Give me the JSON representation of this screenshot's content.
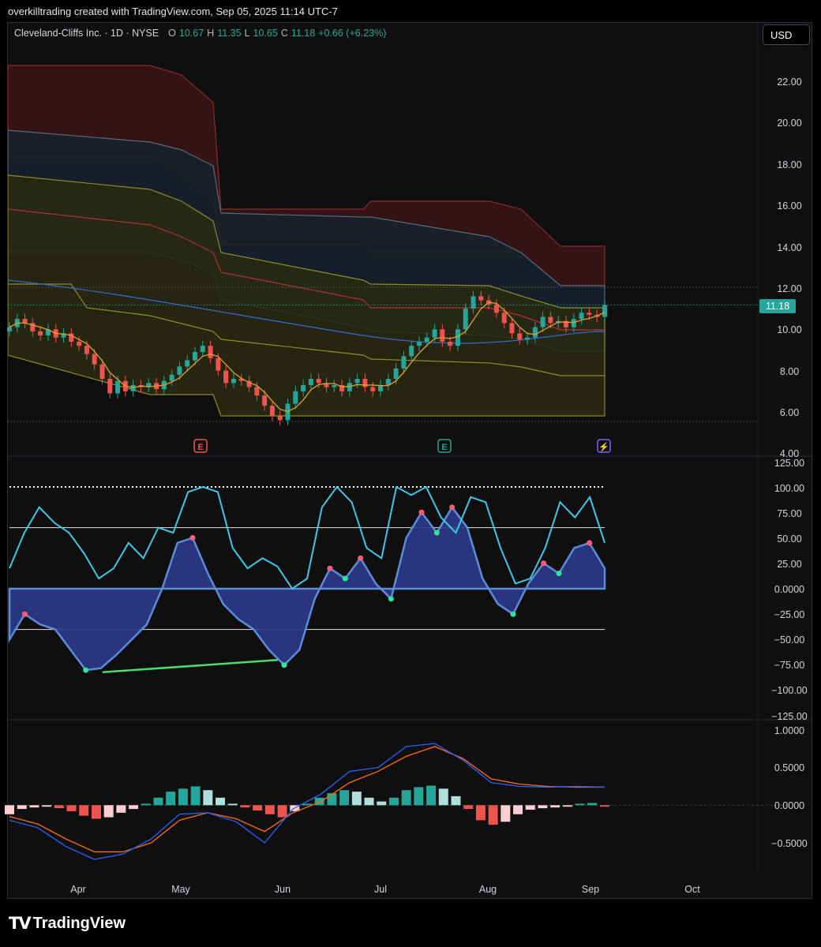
{
  "caption": "overkilltrading created with TradingView.com, Sep 05, 2025 11:14 UTC-7",
  "header": {
    "symbol": "Cleveland-Cliffs Inc. · 1D · NYSE",
    "o_label": "O",
    "o_value": "10.67",
    "h_label": "H",
    "h_value": "11.35",
    "l_label": "L",
    "l_value": "10.65",
    "c_label": "C",
    "c_value": "11.18",
    "change": "+0.66 (+6.23%)",
    "currency": "USD"
  },
  "logo": {
    "mark": "TV",
    "text": "TradingView"
  },
  "colors": {
    "up": "#26a69a",
    "down": "#ef5350",
    "price_line": "#26a69a",
    "wave_line": "#3cc8e8",
    "wave_fill": "#2e3a8c",
    "macd": "#2962ff",
    "signal": "#ff6d00",
    "earnings_down": "#ef5350",
    "earnings_up": "#26a69a",
    "dividend": "#7b61ff"
  },
  "events": [
    {
      "label": "E",
      "month": "May",
      "kind": "earnings_down"
    },
    {
      "label": "E",
      "month": "Jul",
      "kind": "earnings_up"
    },
    {
      "label": "⚡",
      "month": "Sep",
      "kind": "dividend"
    }
  ],
  "chart_data": [
    {
      "type": "candlestick",
      "title": "Cleveland-Cliffs Inc. · 1D · NYSE",
      "last_price": 11.18,
      "last_price_label": "11.18",
      "y_ticks": [
        "22.00",
        "20.00",
        "18.00",
        "16.00",
        "14.00",
        "12.00",
        "10.00",
        "8.00",
        "6.00",
        "4.00"
      ],
      "ylim": [
        4,
        24
      ],
      "x_ticks": [
        "Apr",
        "May",
        "Jun",
        "Jul",
        "Aug",
        "Sep",
        "Oct"
      ],
      "close": [
        10.1,
        10.5,
        10.3,
        9.9,
        9.7,
        10.0,
        9.6,
        9.8,
        9.4,
        9.2,
        8.8,
        8.3,
        7.6,
        6.9,
        7.5,
        7.0,
        7.3,
        7.2,
        7.4,
        7.1,
        7.5,
        7.8,
        8.2,
        8.5,
        8.9,
        9.2,
        8.6,
        8.0,
        7.4,
        7.6,
        7.5,
        7.2,
        6.8,
        6.3,
        5.8,
        5.6,
        6.4,
        7.0,
        7.3,
        7.6,
        7.4,
        7.2,
        7.3,
        7.0,
        7.4,
        7.6,
        7.2,
        7.0,
        7.3,
        7.6,
        8.1,
        8.7,
        9.2,
        9.4,
        9.6,
        10.0,
        9.4,
        9.2,
        10.0,
        11.0,
        11.6,
        11.4,
        11.2,
        10.8,
        10.3,
        9.8,
        9.5,
        9.6,
        10.1,
        10.6,
        10.3,
        10.4,
        10.1,
        10.5,
        10.8,
        10.7,
        10.6,
        11.18
      ]
    },
    {
      "type": "line",
      "y_ticks": [
        "125.00",
        "100.00",
        "75.00",
        "50.00",
        "25.00",
        "0.0000",
        "−25.00",
        "−50.00",
        "−75.00",
        "−100.00",
        "−125.00"
      ],
      "ylim": [
        -125,
        125
      ],
      "levels": [
        100,
        60,
        0,
        -40
      ],
      "series": [
        {
          "values": [
            20,
            55,
            80,
            65,
            55,
            35,
            10,
            20,
            45,
            30,
            60,
            55,
            95,
            100,
            95,
            40,
            20,
            30,
            22,
            0,
            10,
            80,
            100,
            85,
            40,
            30,
            100,
            92,
            100,
            70,
            55,
            90,
            85,
            40,
            5,
            10,
            40,
            85,
            70,
            90,
            45
          ]
        },
        {
          "values": [
            -50,
            -25,
            -35,
            -40,
            -60,
            -80,
            -78,
            -65,
            -50,
            -35,
            0,
            45,
            50,
            15,
            -15,
            -30,
            -40,
            -60,
            -75,
            -60,
            -10,
            20,
            10,
            30,
            5,
            -10,
            50,
            75,
            55,
            80,
            60,
            10,
            -15,
            -25,
            5,
            25,
            15,
            40,
            45,
            20
          ]
        }
      ],
      "annotations": [
        {
          "type": "divergence",
          "from": -82,
          "to": -70
        }
      ]
    },
    {
      "type": "bar",
      "y_ticks": [
        "1.0000",
        "0.5000",
        "0.0000",
        "−0.5000"
      ],
      "ylim": [
        -0.75,
        1.05
      ],
      "histogram": [
        -0.12,
        -0.05,
        -0.03,
        -0.02,
        -0.04,
        -0.08,
        -0.14,
        -0.18,
        -0.16,
        -0.1,
        -0.05,
        0.02,
        0.1,
        0.18,
        0.22,
        0.25,
        0.2,
        0.1,
        0.02,
        -0.03,
        -0.07,
        -0.12,
        -0.16,
        -0.08,
        0.02,
        0.1,
        0.16,
        0.2,
        0.18,
        0.1,
        0.05,
        0.1,
        0.2,
        0.24,
        0.26,
        0.22,
        0.12,
        -0.05,
        -0.2,
        -0.26,
        -0.22,
        -0.12,
        -0.06,
        -0.04,
        -0.03,
        -0.02,
        0.02,
        0.03,
        -0.02
      ],
      "series": [
        {
          "values": [
            -0.2,
            -0.3,
            -0.55,
            -0.72,
            -0.65,
            -0.45,
            -0.12,
            -0.1,
            -0.22,
            -0.5,
            -0.05,
            0.15,
            0.45,
            0.5,
            0.78,
            0.82,
            0.6,
            0.3,
            0.25,
            0.24,
            0.25,
            0.24
          ]
        },
        {
          "values": [
            -0.15,
            -0.25,
            -0.45,
            -0.62,
            -0.62,
            -0.5,
            -0.2,
            -0.1,
            -0.18,
            -0.35,
            -0.1,
            0.05,
            0.3,
            0.45,
            0.65,
            0.78,
            0.62,
            0.35,
            0.28,
            0.25,
            0.24,
            0.24
          ]
        }
      ]
    }
  ]
}
